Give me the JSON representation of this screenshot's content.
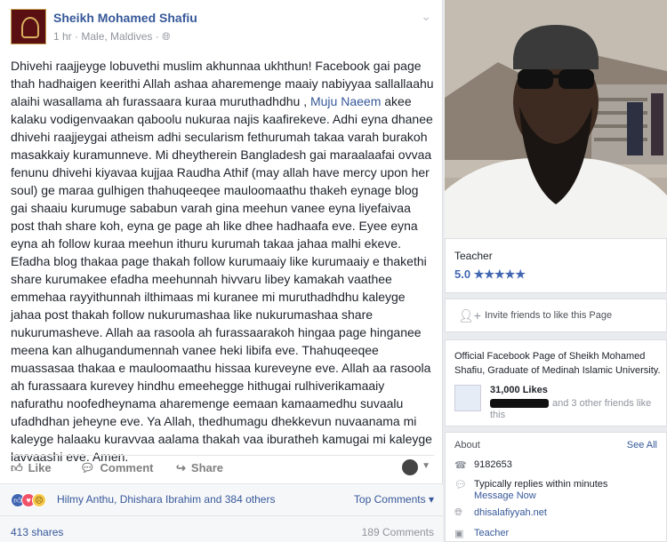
{
  "post": {
    "author": "Sheikh Mohamed Shafiu",
    "time": "1 hr",
    "location": "Male, Maldives",
    "body_before_mention": "Dhivehi raajjeyge lobuvethi muslim akhunnaa ukhthun! Facebook gai page thah hadhaigen keerithi Allah ashaa aharemenge maaiy nabiyyaa sallallaahu alaihi wasallama ah furassaara kuraa muruthadhdhu ,",
    "mention": "Muju Naeem",
    "body_after_mention": "akee kalaku vodigenvaakan qaboolu nukuraa najis kaafirekeve. Adhi eyna dhanee dhivehi raajjeygai atheism adhi secularism fethurumah takaa varah burakoh masakkaiy kuramunneve. Mi dheytherein Bangladesh gai maraalaafai ovvaa fenunu dhivehi kiyavaa kujjaa Raudha Athif (may allah have mercy upon her soul) ge maraa gulhigen thahuqeeqee mauloomaathu thakeh eynage blog gai shaaiu kurumuge sababun varah gina meehun vanee eyna liyefaivaa post thah share koh, eyna ge page ah like dhee hadhaafa eve. Eyee eyna eyna ah follow kuraa meehun ithuru kurumah takaa jahaa malhi ekeve. Efadha blog thakaa page thakah follow kurumaaiy like kurumaaiy e thakethi share kurumakee efadha meehunnah hivvaru libey kamakah vaathee emmehaa rayyithunnah ilthimaas mi kuranee mi muruthadhdhu kaleyge jahaa post thakah follow nukurumashaa like nukurumashaa share nukurumasheve. Allah aa rasoola ah furassaarakoh hingaa page hinganee meena kan alhugandumennah vanee heki libifa eve. Thahuqeeqee muassasaa thakaa e mauloomaathu hissaa kureveyne eve. Allah aa rasoola ah furassaara kurevey hindhu emeehegge hithugai rulhiverikamaaiy nafurathu noofedheynama aharemenge eemaan kamaamedhu suvaalu ufadhdhan jeheyne eve. Ya Allah, thedhumagu dhekkevun nuvaanama mi kaleyge halaaku kuravvaa aalama thakah vaa iburatheh kamugai mi kaleyge lavvaashi eve. Amen.",
    "actions": {
      "like": "Like",
      "comment": "Comment",
      "share": "Share"
    },
    "reactions_text": "Hilmy Anthu, Dhishara Ibrahim and 384 others",
    "top_comments": "Top Comments",
    "shares": "413 shares",
    "comments_count": "189 Comments"
  },
  "sidebar": {
    "category": "Teacher",
    "rating": "5.0",
    "stars": "★★★★★",
    "invite": "Invite friends to like this Page",
    "official": "Official Facebook Page of Sheikh Mohamed Shafiu, Graduate of Medinah Islamic University.",
    "likes_count": "31,000 Likes",
    "likes_others": "and 3 other friends like",
    "likes_this": "this",
    "about_heading": "About",
    "see_all": "See All",
    "phone": "9182653",
    "replies": "Typically replies within minutes",
    "message_now": "Message Now",
    "website": "dhisalafiyyah.net",
    "teacher": "Teacher"
  }
}
